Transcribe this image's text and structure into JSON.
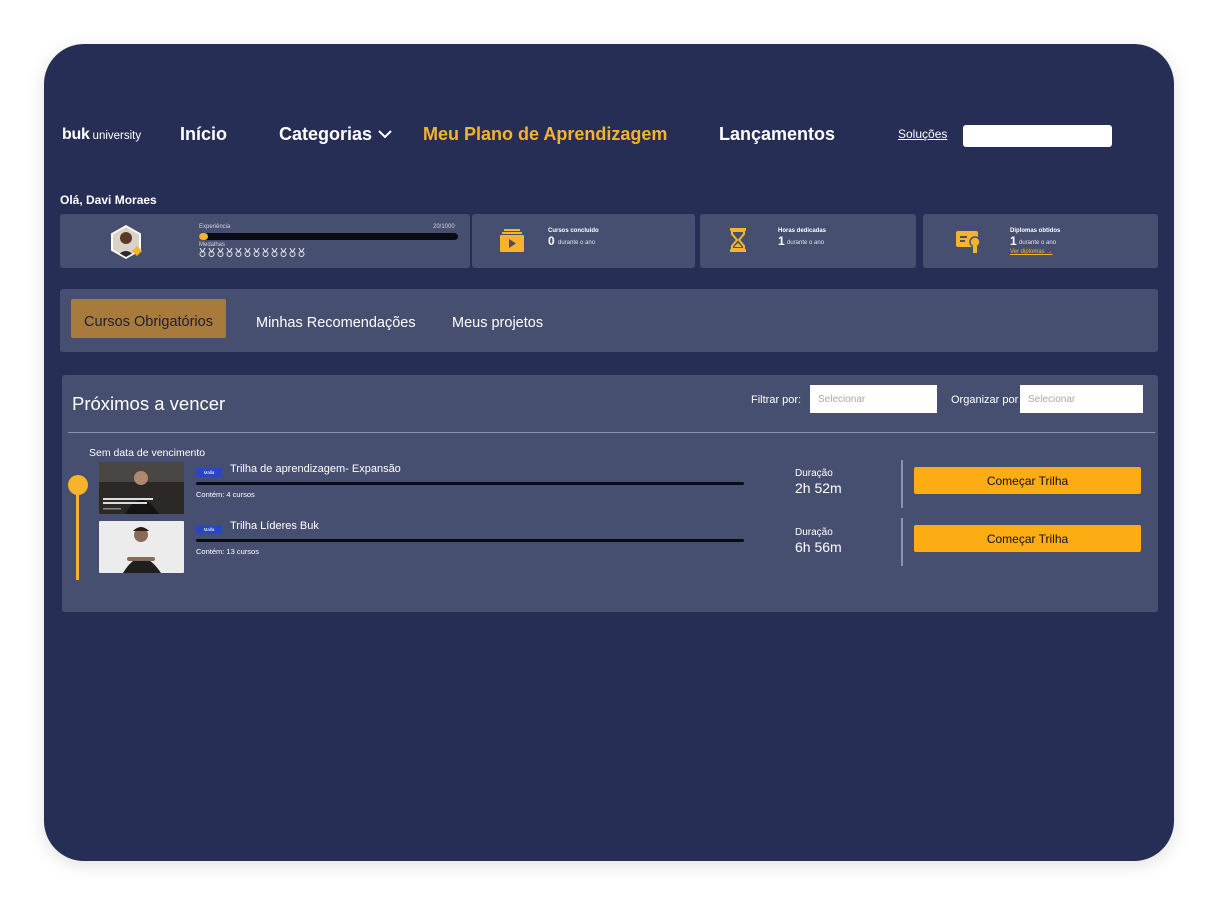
{
  "nav": {
    "logo_bold": "buk",
    "logo_rest": "university",
    "items": [
      {
        "label": "Início"
      },
      {
        "label": "Categorias"
      },
      {
        "label": "Meu Plano de Aprendizagem"
      },
      {
        "label": "Lançamentos"
      }
    ],
    "solutions_link": "Soluções",
    "search_value": ""
  },
  "greeting": "Olá, Davi Moraes",
  "profile": {
    "xp_label": "Experiência",
    "xp_value": "20/1000",
    "xp_progress": 0.02,
    "medals_label": "Medalhas",
    "medal_count": 12
  },
  "stats": [
    {
      "title": "Cursos concluido",
      "value": "0",
      "sub": "durante o ano",
      "icon": "play-folder-icon"
    },
    {
      "title": "Horas dedicadas",
      "value": "1",
      "sub": "durante o ano",
      "icon": "hourglass-icon"
    },
    {
      "title": "Diplomas obtidos",
      "value": "1",
      "sub": "durante o ano",
      "link": "Ver diplomas",
      "icon": "certificate-icon"
    }
  ],
  "tabs": [
    {
      "label": "Cursos Obrigatórios",
      "active": true
    },
    {
      "label": "Minhas Recomendações",
      "active": false
    },
    {
      "label": "Meus projetos",
      "active": false
    }
  ],
  "panel": {
    "title": "Próximos a vencer",
    "filter_label": "Filtrar por:",
    "filter_placeholder": "Selecionar",
    "sort_label": "Organizar por",
    "sort_placeholder": "Selecionar",
    "section_label": "Sem data de vencimento",
    "courses": [
      {
        "tag": "Malla",
        "title": "Trilha de aprendizagem- Expansão",
        "count": "Contém: 4 cursos",
        "duration_label": "Duração",
        "duration": "2h 52m",
        "cta": "Começar Trilha"
      },
      {
        "tag": "Malla",
        "title": "Trilha Líderes Buk",
        "count": "Contém: 13 cursos",
        "duration_label": "Duração",
        "duration": "6h 56m",
        "cta": "Começar Trilha"
      }
    ]
  },
  "colors": {
    "background": "#272e55",
    "card": "#474f70",
    "accent": "#f6b32b",
    "button": "#fdac13",
    "active_tab": "#a87b3d"
  }
}
